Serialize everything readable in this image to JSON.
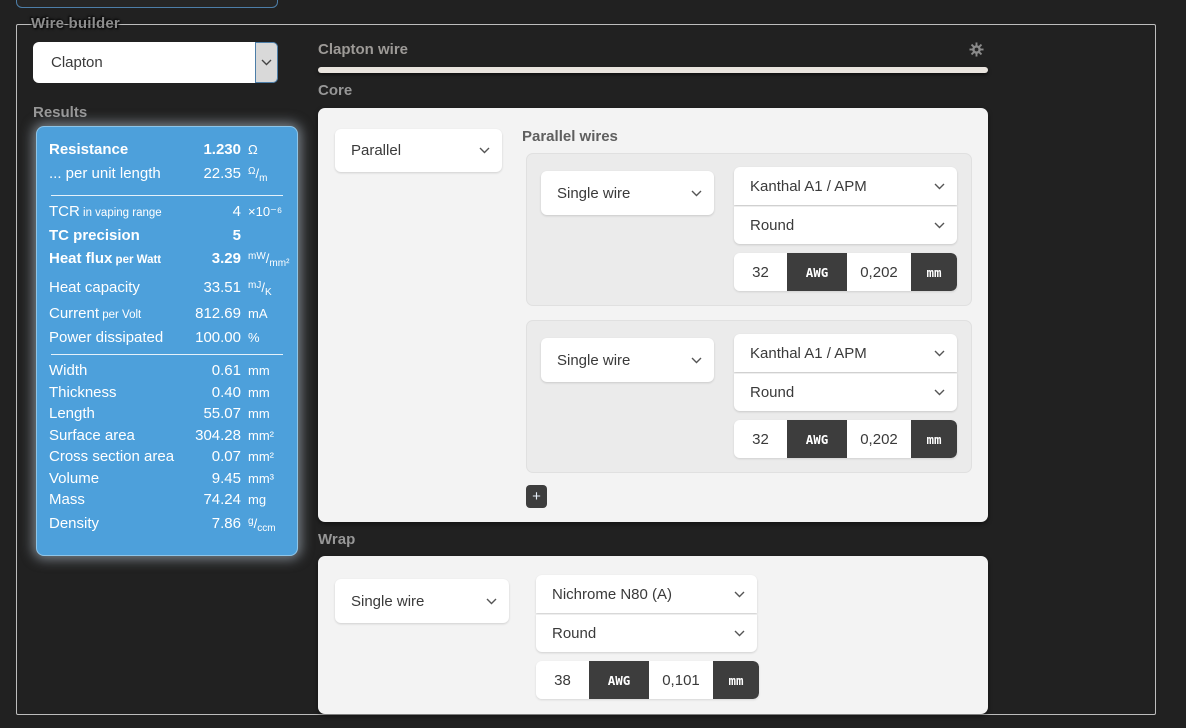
{
  "colors": {
    "background": "#212121",
    "results_blue": "#4da0db",
    "focus_blue": "#4d7ea8",
    "dark_button": "#3d3d3d",
    "panel_light": "#f3f3f3"
  },
  "wire_builder": {
    "legend": "Wire builder",
    "type_select_value": "Clapton"
  },
  "results": {
    "heading": "Results",
    "groups": [
      [
        {
          "label": "Resistance",
          "small": "",
          "bold": true,
          "value": "1.230",
          "unit": {
            "type": "plain",
            "text": "Ω"
          }
        },
        {
          "label": "... per unit length",
          "small": "",
          "bold": false,
          "value": "22.35",
          "unit": {
            "type": "frac",
            "num": "Ω",
            "den": "m"
          }
        }
      ],
      [
        {
          "label": "TCR",
          "small": " in vaping range",
          "bold": false,
          "value": "4",
          "unit": {
            "type": "plain",
            "text": "×10⁻⁶"
          }
        },
        {
          "label": "TC precision",
          "small": "",
          "bold": true,
          "value": "5",
          "unit": {
            "type": "plain",
            "text": ""
          }
        },
        {
          "label": "Heat flux",
          "small": " per Watt",
          "bold": true,
          "value": "3.29",
          "unit": {
            "type": "frac",
            "num": "mW",
            "den": "mm²"
          }
        },
        {
          "label": "Heat capacity",
          "small": "",
          "bold": false,
          "value": "33.51",
          "unit": {
            "type": "frac",
            "num": "mJ",
            "den": "K"
          }
        },
        {
          "label": "Current",
          "small": " per Volt",
          "bold": false,
          "value": "812.69",
          "unit": {
            "type": "plain",
            "text": "mA"
          }
        },
        {
          "label": "Power dissipated",
          "small": "",
          "bold": false,
          "value": "100.00",
          "unit": {
            "type": "plain",
            "text": "%"
          }
        }
      ],
      [
        {
          "label": "Width",
          "small": "",
          "bold": false,
          "value": "0.61",
          "unit": {
            "type": "plain",
            "text": "mm"
          }
        },
        {
          "label": "Thickness",
          "small": "",
          "bold": false,
          "value": "0.40",
          "unit": {
            "type": "plain",
            "text": "mm"
          }
        },
        {
          "label": "Length",
          "small": "",
          "bold": false,
          "value": "55.07",
          "unit": {
            "type": "plain",
            "text": "mm"
          }
        },
        {
          "label": "Surface area",
          "small": "",
          "bold": false,
          "value": "304.28",
          "unit": {
            "type": "plain",
            "text": "mm²"
          }
        },
        {
          "label": "Cross section area",
          "small": "",
          "bold": false,
          "value": "0.07",
          "unit": {
            "type": "plain",
            "text": "mm²"
          }
        },
        {
          "label": "Volume",
          "small": "",
          "bold": false,
          "value": "9.45",
          "unit": {
            "type": "plain",
            "text": "mm³"
          }
        },
        {
          "label": "Mass",
          "small": "",
          "bold": false,
          "value": "74.24",
          "unit": {
            "type": "plain",
            "text": "mg"
          }
        },
        {
          "label": "Density",
          "small": "",
          "bold": false,
          "value": "7.86",
          "unit": {
            "type": "frac",
            "num": "g",
            "den": "ccm"
          }
        }
      ]
    ]
  },
  "main": {
    "title": "Clapton wire",
    "core": {
      "heading": "Core",
      "structure_select_value": "Parallel",
      "group_label": "Parallel wires",
      "wires": [
        {
          "type": "Single wire",
          "material": "Kanthal A1 / APM",
          "profile": "Round",
          "gauge": "32",
          "gauge_unit": "AWG",
          "diameter": "0,202",
          "diameter_unit": "mm"
        },
        {
          "type": "Single wire",
          "material": "Kanthal A1 / APM",
          "profile": "Round",
          "gauge": "32",
          "gauge_unit": "AWG",
          "diameter": "0,202",
          "diameter_unit": "mm"
        }
      ],
      "add_button_label": "+"
    },
    "wrap": {
      "heading": "Wrap",
      "wire": {
        "type": "Single wire",
        "material": "Nichrome N80 (A)",
        "profile": "Round",
        "gauge": "38",
        "gauge_unit": "AWG",
        "diameter": "0,101",
        "diameter_unit": "mm"
      }
    }
  }
}
